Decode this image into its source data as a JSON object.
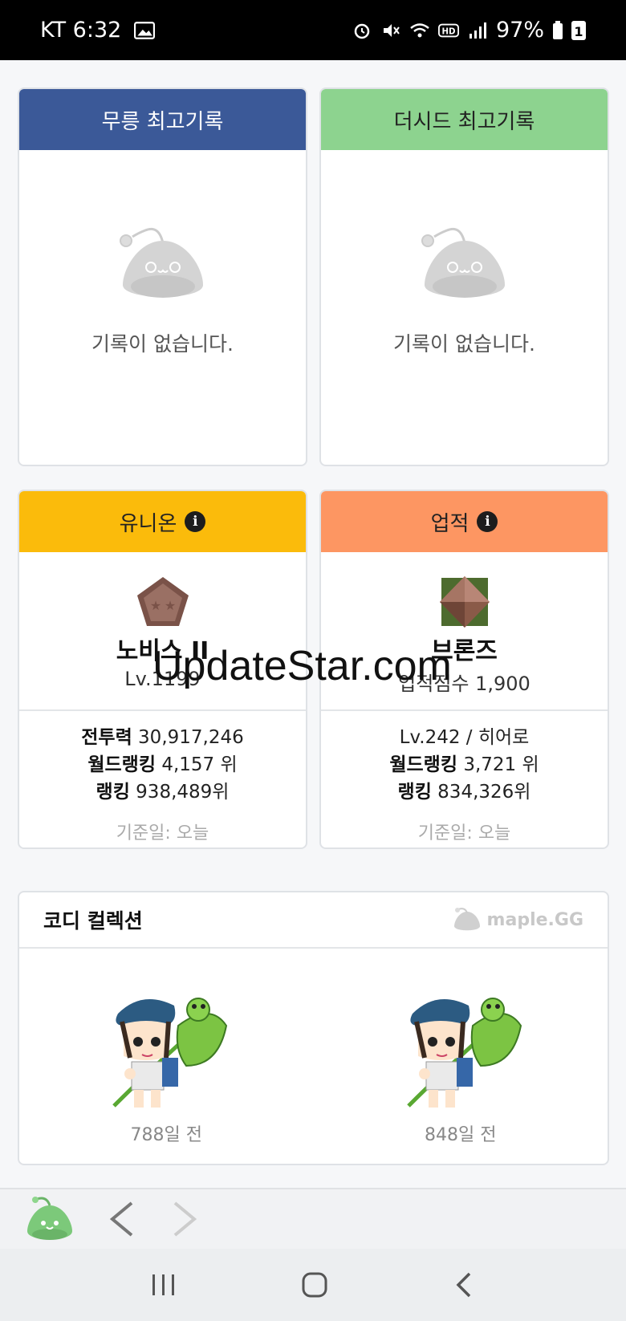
{
  "status_bar": {
    "carrier_time": "KT 6:32",
    "battery": "97%",
    "icons": [
      "image-icon",
      "alarm-icon",
      "mute-icon",
      "wifi-icon",
      "hd-icon",
      "signal-icon",
      "battery-icon",
      "sim-icon"
    ]
  },
  "cards": {
    "mureung": {
      "title": "무릉 최고기록",
      "empty_text": "기록이 없습니다.",
      "color": "#3b5998"
    },
    "theseed": {
      "title": "더시드 최고기록",
      "empty_text": "기록이 없습니다.",
      "color": "#8dd38f"
    },
    "union": {
      "title": "유니온",
      "color": "#fbbb0b",
      "grade": "노비스 II",
      "sub": "Lv.1199",
      "power_label": "전투력",
      "power_value": "30,917,246",
      "world_label": "월드랭킹",
      "world_value": "4,157 위",
      "rank_label": "랭킹",
      "rank_value": "938,489위",
      "date": "기준일: 오늘"
    },
    "achievement": {
      "title": "업적",
      "color": "#fd9662",
      "grade": "브론즈",
      "sub": "업적점수 1,900",
      "level_job": "Lv.242 / 히어로",
      "world_label": "월드랭킹",
      "world_value": "3,721 위",
      "rank_label": "랭킹",
      "rank_value": "834,326위",
      "date": "기준일: 오늘"
    }
  },
  "coordi": {
    "title": "코디 컬렉션",
    "logo_text": "maple.GG",
    "items": [
      {
        "date": "788일 전"
      },
      {
        "date": "848일 전"
      }
    ]
  },
  "watermark": "UpdateStar.com"
}
